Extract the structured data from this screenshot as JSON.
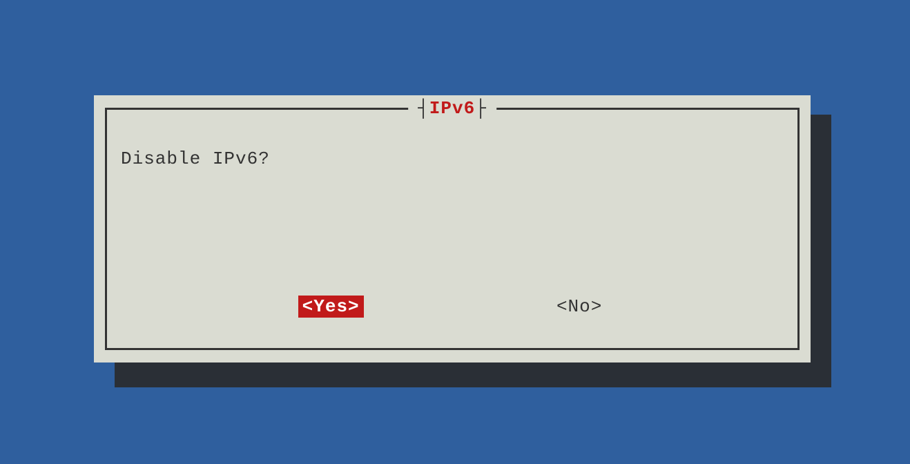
{
  "dialog": {
    "title": "IPv6",
    "prompt": "Disable IPv6?",
    "buttons": {
      "yes": "<Yes>",
      "no": "<No>"
    }
  }
}
